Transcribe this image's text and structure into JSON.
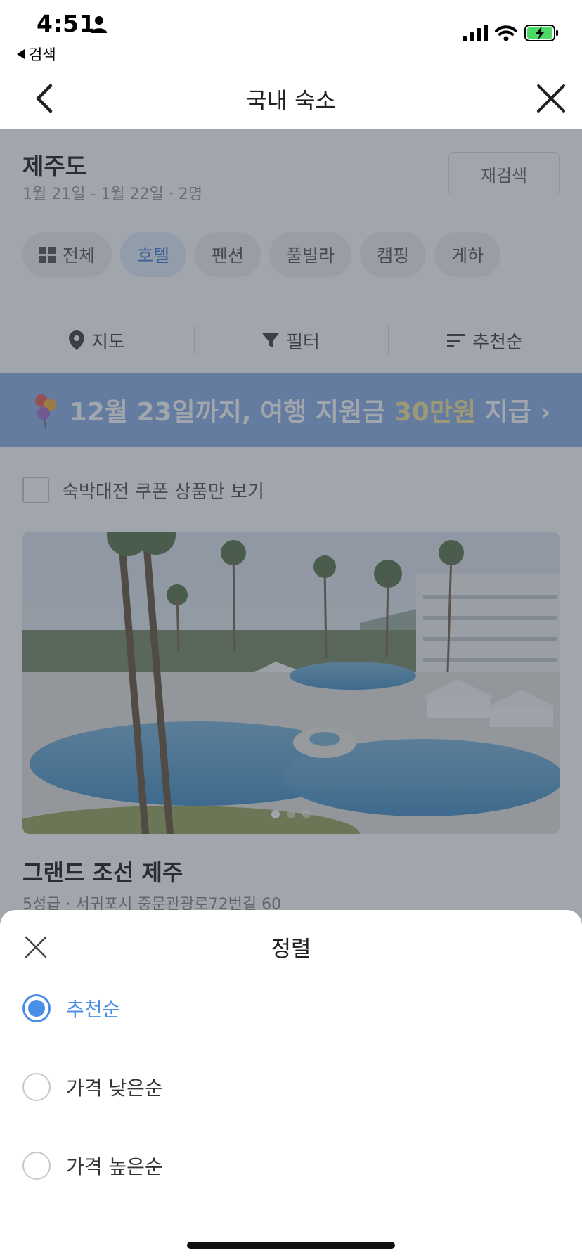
{
  "status_bar": {
    "time": "4:51",
    "back_app": "검색"
  },
  "nav": {
    "title": "국내 숙소"
  },
  "search": {
    "region": "제주도",
    "dates_guests": "1월 21일 - 1월 22일 · 2명",
    "research_label": "재검색"
  },
  "categories": [
    {
      "label": "전체"
    },
    {
      "label": "호텔"
    },
    {
      "label": "펜션"
    },
    {
      "label": "풀빌라"
    },
    {
      "label": "캠핑"
    },
    {
      "label": "게하"
    }
  ],
  "toolbar": {
    "map_label": "지도",
    "filter_label": "필터",
    "sort_label": "추천순"
  },
  "banner": {
    "text_part1": "12월 23일까지, 여행 지원금 ",
    "text_highlight": "30만원",
    "text_part2": " 지급 ›"
  },
  "coupon_filter_label": "숙박대전 쿠폰 상품만 보기",
  "hotel": {
    "name": "그랜드 조선 제주",
    "meta": "5성급 · 서귀포시 중문관광로72번길 60"
  },
  "sheet": {
    "title": "정렬",
    "options": [
      {
        "label": "추천순",
        "selected": true
      },
      {
        "label": "가격 낮은순",
        "selected": false
      },
      {
        "label": "가격 높은순",
        "selected": false
      }
    ]
  },
  "colors": {
    "accent": "#4a8ee8",
    "overlay": "#323a4b",
    "banner": "#8fb3e8"
  }
}
